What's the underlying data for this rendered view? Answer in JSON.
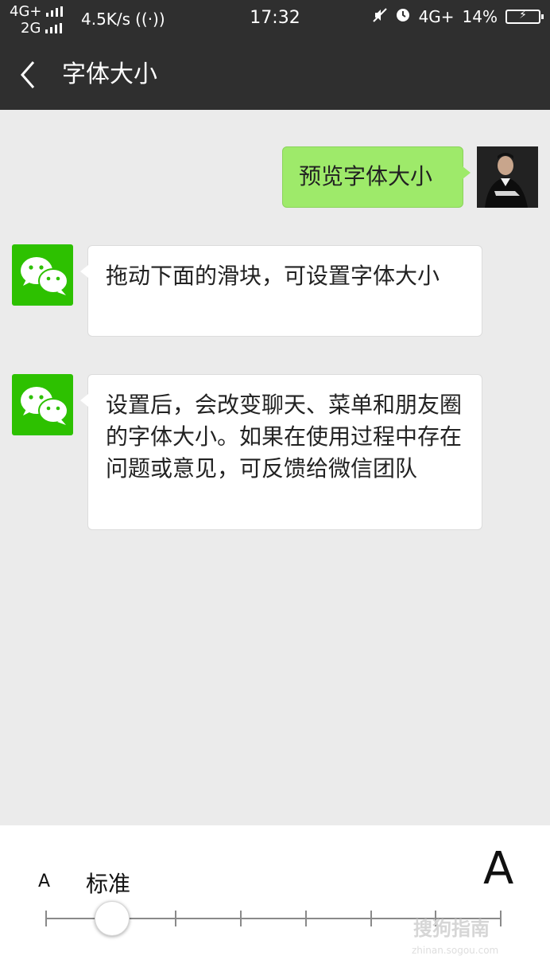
{
  "status_bar": {
    "net1": "4G+",
    "net2": "2G",
    "speed": "4.5K/s",
    "time": "17:32",
    "net_right": "4G+",
    "battery": "14%"
  },
  "header": {
    "title": "字体大小"
  },
  "chat": {
    "messages": [
      {
        "from": "me",
        "text": "预览字体大小"
      },
      {
        "from": "wechat",
        "text": "拖动下面的滑块，可设置字体大小"
      },
      {
        "from": "wechat",
        "text": "设置后，会改变聊天、菜单和朋友圈的字体大小。如果在使用过程中存在问题或意见，可反馈给微信团队"
      }
    ]
  },
  "font_slider": {
    "small_label": "A",
    "current_label": "标准",
    "large_label": "A",
    "positions": 8,
    "selected_index": 1
  },
  "watermark": {
    "text": "搜狗指南",
    "url": "zhinan.sogou.com"
  },
  "colors": {
    "header_bg": "#2f2f2f",
    "chat_bg": "#ebebeb",
    "my_bubble": "#9eea6a",
    "wechat_green": "#2dc100"
  }
}
